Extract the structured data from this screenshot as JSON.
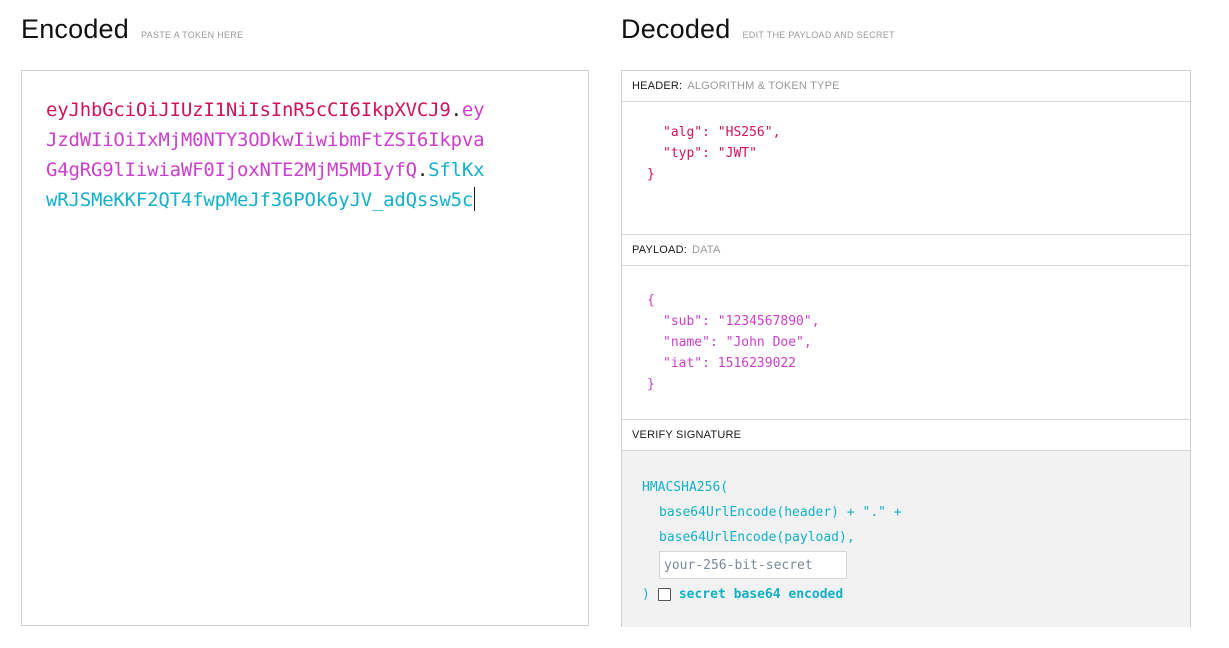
{
  "encoded": {
    "title": "Encoded",
    "hint": "PASTE A TOKEN HERE",
    "token_lines": [
      [
        {
          "t": "eyJhbGciOiJIUzI1NiIsInR5cCI6IkpXVCJ9",
          "c": "header"
        },
        {
          "t": ".",
          "c": "dot"
        },
        {
          "t": "ey",
          "c": "payload"
        }
      ],
      [
        {
          "t": "JzdWIiOiIxMjM0NTY3ODkwIiwibmFtZSI6Ikpva",
          "c": "payload"
        }
      ],
      [
        {
          "t": "G4gRG9lIiwiaWF0IjoxNTE2MjM5MDIyfQ",
          "c": "payload"
        },
        {
          "t": ".",
          "c": "dot"
        },
        {
          "t": "SflKx",
          "c": "sig"
        }
      ],
      [
        {
          "t": "wRJSMeKKF2QT4fwpMeJf36POk6yJV_adQssw5c",
          "c": "sig"
        }
      ]
    ]
  },
  "decoded": {
    "title": "Decoded",
    "hint": "EDIT THE PAYLOAD AND SECRET",
    "header_section": {
      "label": "HEADER:",
      "sub": "ALGORITHM & TOKEN TYPE",
      "lines": [
        {
          "text": "\"alg\": \"HS256\",",
          "indent": true
        },
        {
          "text": "\"typ\": \"JWT\"",
          "indent": true
        },
        {
          "text": "}",
          "indent": false
        }
      ]
    },
    "payload_section": {
      "label": "PAYLOAD:",
      "sub": "DATA",
      "lines": [
        {
          "text": "{",
          "indent": false
        },
        {
          "text": "\"sub\": \"1234567890\",",
          "indent": true
        },
        {
          "text": "\"name\": \"John Doe\",",
          "indent": true
        },
        {
          "text": "\"iat\": 1516239022",
          "indent": true
        },
        {
          "text": "}",
          "indent": false
        }
      ]
    },
    "verify_section": {
      "label": "VERIFY SIGNATURE",
      "fn_open": "HMACSHA256(",
      "arg1": "base64UrlEncode(header) + \".\" +",
      "arg2": "base64UrlEncode(payload),",
      "secret_value": "your-256-bit-secret",
      "close_paren": ")",
      "checkbox_label": "secret base64 encoded",
      "checkbox_checked": false
    }
  },
  "colors": {
    "header": "#d0135d",
    "payload": "#cc3fcc",
    "signature": "#12b0c9"
  }
}
